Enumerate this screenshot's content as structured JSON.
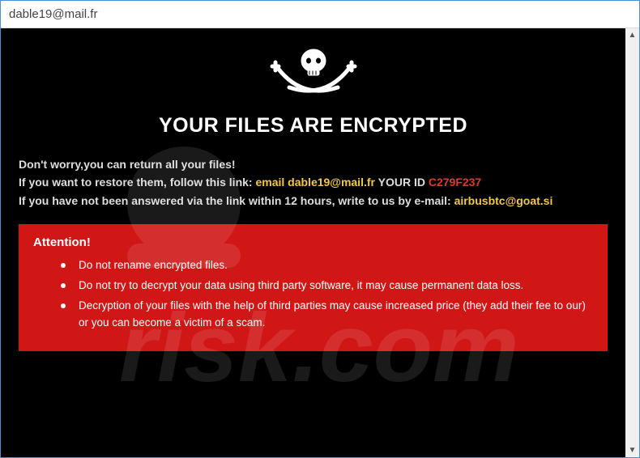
{
  "window": {
    "title": "dable19@mail.fr"
  },
  "heading": "YOUR FILES ARE ENCRYPTED",
  "lines": {
    "l1": "Don't worry,you can return all your files!",
    "l2_a": "If you want to restore them, follow this link: ",
    "l2_b": "email dable19@mail.fr",
    "l2_c": "  YOUR ID ",
    "l2_d": "C279F237",
    "l3_a": "If you have not been answered via the link within 12 hours, write to us by e-mail: ",
    "l3_b": "airbusbtc@goat.si"
  },
  "attention": {
    "title": "Attention!",
    "items": [
      "Do not rename encrypted files.",
      "Do not try to decrypt your data using third party software, it may cause permanent data loss.",
      "Decryption of your files with the help of third parties may cause increased price (they add their fee to our) or you can become a victim of a scam."
    ]
  },
  "scroll": {
    "up": "▲",
    "down": "▼"
  }
}
